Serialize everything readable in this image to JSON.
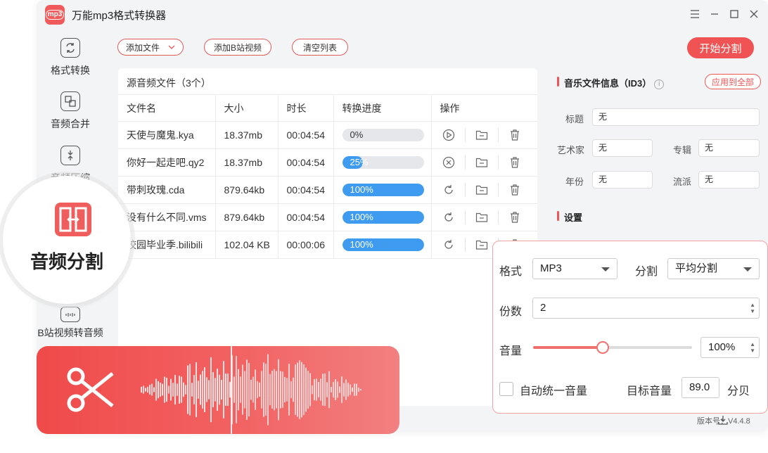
{
  "app": {
    "title": "万能mp3格式转换器",
    "logo_text": "mp3"
  },
  "sidebar": {
    "items": [
      {
        "label": "格式转换",
        "icon": "convert-icon"
      },
      {
        "label": "音频合并",
        "icon": "merge-icon"
      },
      {
        "label": "音频压缩",
        "icon": "compress-icon"
      },
      {
        "label": "B站视频转音频",
        "icon": "bilibili-tv-icon"
      }
    ],
    "active": {
      "label": "音频分割",
      "icon": "split-icon"
    }
  },
  "toolbar": {
    "add_file": "添加文件",
    "add_bilibili": "添加B站视频",
    "clear_list": "清空列表",
    "start": "开始分割"
  },
  "files": {
    "title": "源音频文件（3个）",
    "columns": [
      "文件名",
      "大小",
      "时长",
      "转换进度",
      "操作"
    ],
    "rows": [
      {
        "name": "天使与魔鬼.kya",
        "size": "18.37mb",
        "duration": "00:04:54",
        "progress": 0,
        "progress_label": "0%",
        "action": "play"
      },
      {
        "name": "你好一起走吧.qy2",
        "size": "18.37mb",
        "duration": "00:04:54",
        "progress": 25,
        "progress_label": "25%",
        "action": "cancel"
      },
      {
        "name": "带刺玫瑰.cda",
        "size": "879.64kb",
        "duration": "00:04:54",
        "progress": 100,
        "progress_label": "100%",
        "action": "redo"
      },
      {
        "name": "没有什么不同.vms",
        "size": "879.64kb",
        "duration": "00:04:54",
        "progress": 100,
        "progress_label": "100%",
        "action": "redo"
      },
      {
        "name": "校园毕业季.bilibili",
        "size": "102.04 KB",
        "duration": "00:00:06",
        "progress": 100,
        "progress_label": "100%",
        "action": "redo"
      }
    ]
  },
  "id3": {
    "heading": "音乐文件信息（ID3）",
    "apply_all": "应用到全部",
    "title_label": "标题",
    "title_value": "无",
    "artist_label": "艺术家",
    "artist_value": "无",
    "album_label": "专辑",
    "album_value": "无",
    "year_label": "年份",
    "year_value": "无",
    "genre_label": "流派",
    "genre_value": "无"
  },
  "settings": {
    "heading": "设置",
    "format_label": "格式",
    "format_value": "MP3",
    "split_label": "分割",
    "split_value": "平均分割",
    "parts_label": "份数",
    "parts_value": "2",
    "volume_label": "音量",
    "volume_value": "100%",
    "volume_level": 0.44,
    "auto_volume_label": "自动统一音量",
    "auto_volume_checked": false,
    "target_label": "目标音量",
    "target_value": "89.0",
    "target_unit": "分贝"
  },
  "version": "版本号：V4.4.8",
  "colors": {
    "accent": "#f05353",
    "progress": "#3e9bf0"
  }
}
